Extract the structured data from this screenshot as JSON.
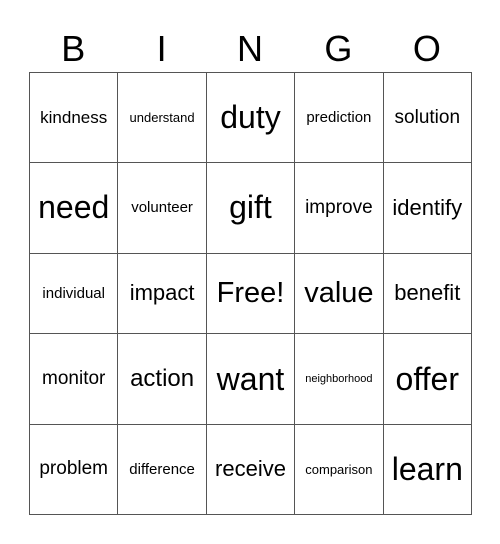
{
  "header": [
    "B",
    "I",
    "N",
    "G",
    "O"
  ],
  "rows": [
    [
      "kindness",
      "understand",
      "duty",
      "prediction",
      "solution"
    ],
    [
      "need",
      "volunteer",
      "gift",
      "improve",
      "identify"
    ],
    [
      "individual",
      "impact",
      "Free!",
      "value",
      "benefit"
    ],
    [
      "monitor",
      "action",
      "want",
      "neighborhood",
      "offer"
    ],
    [
      "problem",
      "difference",
      "receive",
      "comparison",
      "learn"
    ]
  ]
}
